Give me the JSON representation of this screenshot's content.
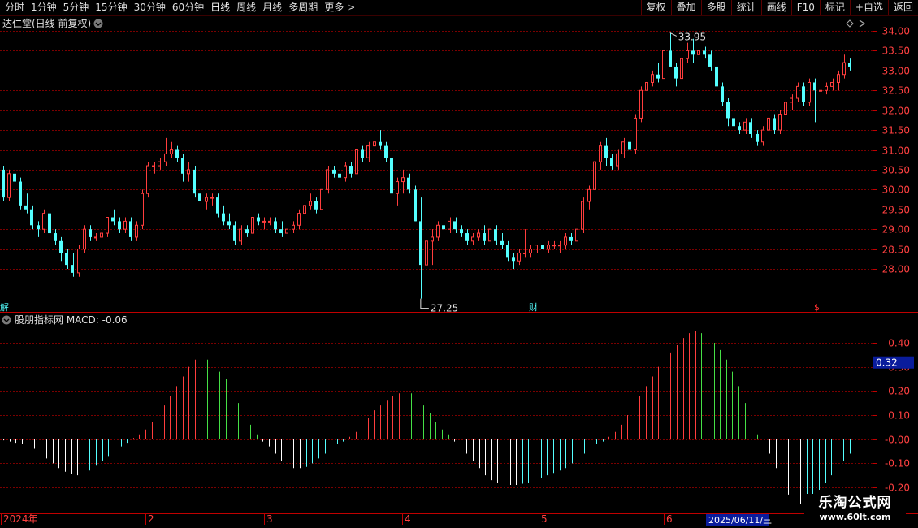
{
  "toolbar": {
    "periods": [
      "分时",
      "1分钟",
      "5分钟",
      "15分钟",
      "30分钟",
      "60分钟",
      "日线",
      "周线",
      "月线",
      "多周期",
      "更多"
    ],
    "active_period": "日线",
    "more_arrow": ">",
    "right_buttons": [
      "复权",
      "叠加",
      "多股",
      "统计",
      "画线",
      "F10",
      "标记",
      "+自选",
      "返回"
    ]
  },
  "price_panel": {
    "title": "达仁堂(日线 前复权)",
    "y_ticks": [
      "34.00",
      "33.50",
      "33.00",
      "32.50",
      "32.00",
      "31.50",
      "31.00",
      "30.50",
      "30.00",
      "29.50",
      "29.00",
      "28.50",
      "28.00"
    ],
    "high_marker": "33.95",
    "low_marker": "27.25",
    "event_markers": [
      "解",
      "财",
      "$"
    ],
    "colors": {
      "up": "#ff3d3d",
      "down": "#54ffff",
      "grid": "#7a0000",
      "border": "#c00000"
    }
  },
  "macd_panel": {
    "title": "股朋指标网 MACD: -0.06",
    "y_ticks": [
      "0.40",
      "0.30",
      "0.20",
      "0.10",
      "-0.00",
      "-0.10",
      "-0.20"
    ],
    "current_value": "0.32",
    "colors": {
      "pos_rising": "#ff3d3d",
      "pos_falling": "#46e046",
      "neg_falling": "#ffffff",
      "neg_rising": "#54ffff",
      "value_box": "#0a1c9c"
    }
  },
  "x_axis": {
    "labels": [
      "2024年",
      "2",
      "3",
      "4",
      "5",
      "6"
    ],
    "cursor_date": "2025/06/11/三"
  },
  "watermark": {
    "line1": "乐淘公式网",
    "line2": "www.60lt.com"
  },
  "chart_data": [
    {
      "type": "candlestick",
      "title": "达仁堂(日线 前复权)",
      "ylim": [
        27.25,
        33.95
      ],
      "x_month_labels": [
        "2024年",
        "2",
        "3",
        "4",
        "5",
        "6"
      ],
      "ohlc": [
        [
          30.5,
          30.6,
          29.7,
          29.8
        ],
        [
          29.8,
          30.5,
          29.7,
          30.4
        ],
        [
          30.4,
          30.6,
          29.9,
          30.2
        ],
        [
          30.2,
          30.3,
          29.5,
          29.6
        ],
        [
          29.6,
          29.9,
          29.4,
          29.5
        ],
        [
          29.5,
          29.6,
          29.0,
          29.1
        ],
        [
          29.1,
          29.2,
          28.8,
          29.0
        ],
        [
          29.0,
          29.5,
          28.9,
          29.4
        ],
        [
          29.4,
          29.5,
          28.8,
          28.9
        ],
        [
          28.9,
          29.0,
          28.6,
          28.7
        ],
        [
          28.7,
          28.8,
          28.2,
          28.4
        ],
        [
          28.4,
          28.5,
          28.0,
          28.1
        ],
        [
          28.1,
          28.4,
          27.8,
          27.9
        ],
        [
          27.9,
          28.6,
          27.8,
          28.5
        ],
        [
          28.5,
          29.1,
          28.4,
          29.0
        ],
        [
          29.0,
          29.1,
          28.7,
          28.8
        ],
        [
          28.8,
          28.9,
          28.7,
          28.8
        ],
        [
          28.8,
          29.0,
          28.5,
          28.9
        ],
        [
          28.9,
          29.3,
          28.8,
          29.3
        ],
        [
          29.3,
          29.5,
          29.1,
          29.2
        ],
        [
          29.2,
          29.3,
          28.9,
          29.0
        ],
        [
          29.0,
          29.3,
          28.9,
          29.2
        ],
        [
          29.2,
          29.3,
          28.7,
          28.8
        ],
        [
          28.8,
          29.2,
          28.7,
          29.1
        ],
        [
          29.1,
          30.0,
          29.0,
          29.9
        ],
        [
          29.9,
          30.7,
          29.8,
          30.6
        ],
        [
          30.6,
          30.7,
          30.4,
          30.6
        ],
        [
          30.6,
          30.8,
          30.5,
          30.7
        ],
        [
          30.7,
          31.3,
          30.6,
          30.9
        ],
        [
          30.9,
          31.2,
          30.8,
          31.0
        ],
        [
          31.0,
          31.1,
          30.7,
          30.8
        ],
        [
          30.8,
          30.9,
          30.2,
          30.4
        ],
        [
          30.4,
          30.7,
          30.2,
          30.5
        ],
        [
          30.5,
          30.6,
          29.8,
          29.9
        ],
        [
          29.9,
          30.1,
          29.6,
          29.7
        ],
        [
          29.7,
          29.9,
          29.5,
          29.8
        ],
        [
          29.8,
          29.9,
          29.6,
          29.8
        ],
        [
          29.8,
          29.9,
          29.3,
          29.4
        ],
        [
          29.4,
          29.6,
          29.1,
          29.2
        ],
        [
          29.2,
          29.4,
          29.0,
          29.1
        ],
        [
          29.1,
          29.2,
          28.6,
          28.7
        ],
        [
          28.7,
          29.1,
          28.6,
          29.0
        ],
        [
          29.0,
          29.1,
          28.8,
          28.9
        ],
        [
          28.9,
          29.4,
          28.8,
          29.3
        ],
        [
          29.3,
          29.4,
          29.1,
          29.2
        ],
        [
          29.2,
          29.3,
          29.0,
          29.2
        ],
        [
          29.2,
          29.3,
          29.1,
          29.2
        ],
        [
          29.2,
          29.3,
          28.9,
          29.0
        ],
        [
          29.0,
          29.2,
          28.8,
          28.9
        ],
        [
          28.9,
          29.1,
          28.7,
          29.0
        ],
        [
          29.0,
          29.2,
          28.9,
          29.1
        ],
        [
          29.1,
          29.5,
          29.0,
          29.4
        ],
        [
          29.4,
          29.7,
          29.3,
          29.6
        ],
        [
          29.6,
          29.9,
          29.5,
          29.7
        ],
        [
          29.7,
          29.8,
          29.4,
          29.5
        ],
        [
          29.5,
          30.1,
          29.4,
          30.0
        ],
        [
          30.0,
          30.6,
          29.9,
          30.5
        ],
        [
          30.5,
          30.6,
          30.3,
          30.4
        ],
        [
          30.4,
          30.5,
          30.2,
          30.3
        ],
        [
          30.3,
          30.7,
          30.2,
          30.6
        ],
        [
          30.6,
          30.7,
          30.3,
          30.4
        ],
        [
          30.4,
          31.1,
          30.3,
          31.0
        ],
        [
          31.0,
          31.1,
          30.7,
          30.8
        ],
        [
          30.8,
          31.2,
          30.7,
          31.1
        ],
        [
          31.1,
          31.3,
          30.9,
          31.2
        ],
        [
          31.2,
          31.5,
          31.0,
          31.1
        ],
        [
          31.1,
          31.2,
          30.7,
          30.8
        ],
        [
          30.8,
          30.9,
          29.6,
          29.9
        ],
        [
          29.9,
          30.3,
          29.6,
          30.2
        ],
        [
          30.2,
          30.5,
          29.9,
          30.3
        ],
        [
          30.3,
          30.4,
          29.9,
          30.0
        ],
        [
          30.0,
          30.1,
          29.2,
          29.2
        ],
        [
          29.2,
          29.8,
          27.25,
          28.1
        ],
        [
          28.1,
          28.8,
          28.0,
          28.7
        ],
        [
          28.7,
          29.0,
          28.1,
          28.8
        ],
        [
          28.8,
          29.2,
          28.7,
          29.1
        ],
        [
          29.1,
          29.3,
          28.9,
          29.0
        ],
        [
          29.0,
          29.3,
          28.9,
          29.2
        ],
        [
          29.2,
          29.3,
          28.9,
          29.0
        ],
        [
          29.0,
          29.1,
          28.8,
          28.9
        ],
        [
          28.9,
          29.0,
          28.6,
          28.7
        ],
        [
          28.7,
          28.9,
          28.6,
          28.8
        ],
        [
          28.8,
          29.0,
          28.7,
          28.9
        ],
        [
          28.9,
          29.1,
          28.6,
          28.7
        ],
        [
          28.7,
          29.1,
          28.6,
          29.0
        ],
        [
          29.0,
          29.1,
          28.6,
          28.7
        ],
        [
          28.7,
          28.9,
          28.5,
          28.6
        ],
        [
          28.6,
          28.7,
          28.2,
          28.3
        ],
        [
          28.3,
          28.4,
          28.0,
          28.2
        ],
        [
          28.2,
          28.5,
          28.1,
          28.4
        ],
        [
          28.4,
          29.0,
          28.3,
          28.4
        ],
        [
          28.4,
          28.6,
          28.3,
          28.5
        ],
        [
          28.5,
          28.6,
          28.4,
          28.6
        ],
        [
          28.6,
          28.7,
          28.4,
          28.5
        ],
        [
          28.5,
          28.7,
          28.4,
          28.6
        ],
        [
          28.6,
          28.7,
          28.5,
          28.6
        ],
        [
          28.6,
          28.7,
          28.4,
          28.6
        ],
        [
          28.6,
          28.9,
          28.5,
          28.8
        ],
        [
          28.8,
          28.9,
          28.6,
          28.7
        ],
        [
          28.7,
          29.1,
          28.6,
          29.0
        ],
        [
          29.0,
          29.8,
          28.9,
          29.7
        ],
        [
          29.7,
          30.1,
          29.5,
          30.0
        ],
        [
          30.0,
          30.8,
          29.9,
          30.7
        ],
        [
          30.7,
          31.2,
          30.5,
          31.1
        ],
        [
          31.1,
          31.3,
          30.6,
          30.8
        ],
        [
          30.8,
          30.9,
          30.5,
          30.6
        ],
        [
          30.6,
          31.0,
          30.5,
          30.9
        ],
        [
          30.9,
          31.3,
          30.8,
          31.2
        ],
        [
          31.2,
          31.4,
          30.9,
          31.0
        ],
        [
          31.0,
          31.9,
          30.9,
          31.8
        ],
        [
          31.8,
          32.6,
          31.7,
          32.5
        ],
        [
          32.5,
          32.8,
          32.3,
          32.7
        ],
        [
          32.7,
          33.0,
          32.6,
          32.9
        ],
        [
          32.9,
          33.2,
          32.7,
          32.8
        ],
        [
          32.8,
          33.6,
          32.7,
          33.5
        ],
        [
          33.5,
          33.95,
          33.4,
          33.1
        ],
        [
          33.1,
          33.2,
          32.6,
          32.8
        ],
        [
          32.8,
          33.4,
          32.7,
          33.3
        ],
        [
          33.3,
          33.7,
          33.2,
          33.5
        ],
        [
          33.5,
          33.8,
          33.2,
          33.4
        ],
        [
          33.4,
          33.6,
          33.2,
          33.5
        ],
        [
          33.5,
          33.6,
          33.3,
          33.4
        ],
        [
          33.4,
          33.5,
          33.0,
          33.1
        ],
        [
          33.1,
          33.2,
          32.5,
          32.6
        ],
        [
          32.6,
          32.7,
          32.1,
          32.2
        ],
        [
          32.2,
          32.3,
          31.6,
          31.8
        ],
        [
          31.8,
          31.9,
          31.5,
          31.6
        ],
        [
          31.6,
          31.7,
          31.4,
          31.5
        ],
        [
          31.5,
          31.8,
          31.4,
          31.7
        ],
        [
          31.7,
          31.8,
          31.3,
          31.4
        ],
        [
          31.4,
          31.5,
          31.1,
          31.2
        ],
        [
          31.2,
          31.6,
          31.1,
          31.5
        ],
        [
          31.5,
          31.9,
          31.4,
          31.8
        ],
        [
          31.8,
          31.9,
          31.4,
          31.5
        ],
        [
          31.5,
          32.0,
          31.4,
          31.9
        ],
        [
          31.9,
          32.3,
          31.8,
          32.2
        ],
        [
          32.2,
          32.4,
          32.0,
          32.3
        ],
        [
          32.3,
          32.7,
          32.2,
          32.6
        ],
        [
          32.6,
          32.7,
          32.1,
          32.2
        ],
        [
          32.2,
          32.8,
          32.1,
          32.7
        ],
        [
          32.7,
          32.8,
          31.7,
          32.5
        ],
        [
          32.5,
          32.6,
          32.4,
          32.5
        ],
        [
          32.5,
          32.7,
          32.4,
          32.6
        ],
        [
          32.6,
          32.8,
          32.5,
          32.7
        ],
        [
          32.7,
          33.0,
          32.5,
          32.9
        ],
        [
          32.9,
          33.4,
          32.8,
          33.2
        ],
        [
          33.2,
          33.3,
          33.0,
          33.1
        ]
      ]
    },
    {
      "type": "bar",
      "title": "股朋指标网 MACD: -0.06",
      "ylim": [
        -0.2,
        0.45
      ],
      "current_value": 0.32,
      "values": [
        -0.005,
        -0.01,
        -0.015,
        -0.02,
        -0.03,
        -0.04,
        -0.06,
        -0.08,
        -0.1,
        -0.12,
        -0.135,
        -0.145,
        -0.15,
        -0.145,
        -0.13,
        -0.11,
        -0.09,
        -0.07,
        -0.05,
        -0.03,
        -0.015,
        0.005,
        0.02,
        0.04,
        0.07,
        0.1,
        0.14,
        0.18,
        0.22,
        0.26,
        0.3,
        0.33,
        0.34,
        0.33,
        0.31,
        0.28,
        0.25,
        0.2,
        0.15,
        0.1,
        0.06,
        0.02,
        -0.01,
        -0.03,
        -0.06,
        -0.09,
        -0.11,
        -0.12,
        -0.12,
        -0.115,
        -0.1,
        -0.08,
        -0.06,
        -0.04,
        -0.02,
        -0.01,
        0.01,
        0.03,
        0.06,
        0.09,
        0.12,
        0.14,
        0.16,
        0.18,
        0.19,
        0.2,
        0.19,
        0.17,
        0.14,
        0.11,
        0.07,
        0.04,
        0.02,
        -0.01,
        -0.03,
        -0.06,
        -0.09,
        -0.12,
        -0.15,
        -0.17,
        -0.18,
        -0.19,
        -0.19,
        -0.19,
        -0.185,
        -0.18,
        -0.17,
        -0.16,
        -0.15,
        -0.14,
        -0.13,
        -0.12,
        -0.1,
        -0.08,
        -0.06,
        -0.04,
        -0.02,
        -0.01,
        0.01,
        0.03,
        0.06,
        0.1,
        0.14,
        0.18,
        0.22,
        0.26,
        0.3,
        0.33,
        0.36,
        0.39,
        0.42,
        0.44,
        0.45,
        0.44,
        0.42,
        0.4,
        0.37,
        0.33,
        0.28,
        0.22,
        0.15,
        0.08,
        0.02,
        -0.02,
        -0.06,
        -0.12,
        -0.18,
        -0.23,
        -0.26,
        -0.27,
        -0.26,
        -0.24,
        -0.21,
        -0.18,
        -0.15,
        -0.12,
        -0.09,
        -0.06
      ]
    }
  ]
}
